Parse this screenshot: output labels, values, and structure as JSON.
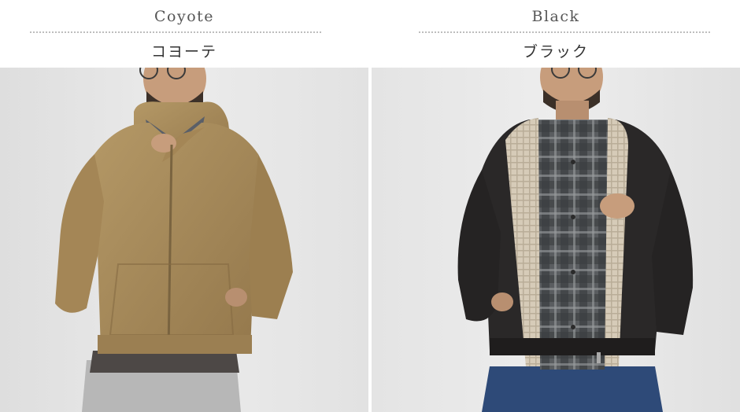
{
  "variants": [
    {
      "name_en": "Coyote",
      "name_ja": "コヨーテ",
      "jacket_color": "#a68a5c",
      "image_icon": "model-wearing-coyote-zip-hoodie"
    },
    {
      "name_en": "Black",
      "name_ja": "ブラック",
      "jacket_color": "#2a2828",
      "image_icon": "model-wearing-black-zip-hoodie"
    }
  ]
}
